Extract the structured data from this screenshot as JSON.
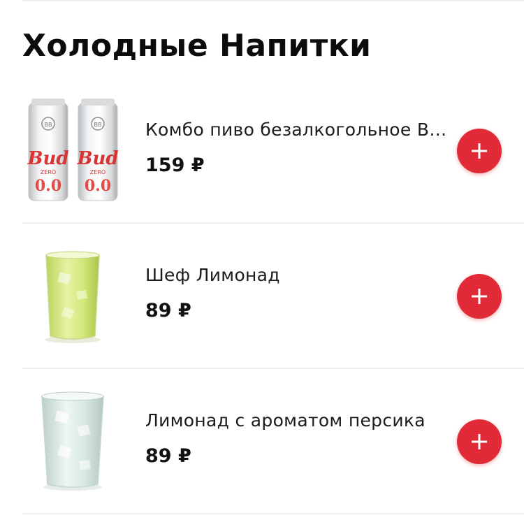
{
  "section": {
    "title": "Холодные Напитки"
  },
  "colors": {
    "accent": "#e02a38",
    "text": "#111111",
    "divider": "#ececec"
  },
  "products": [
    {
      "name": "Комбо пиво безалкогольное Bu...",
      "price": "159 ₽",
      "image": "beer-cans-image",
      "add_icon": "plus-icon"
    },
    {
      "name": "Шеф Лимонад",
      "price": "89 ₽",
      "image": "green-lemonade-glass-image",
      "add_icon": "plus-icon"
    },
    {
      "name": "Лимонад с ароматом персика",
      "price": "89 ₽",
      "image": "clear-lemonade-glass-image",
      "add_icon": "plus-icon"
    }
  ],
  "image_labels": {
    "can_brand": "Bud",
    "can_sub": "ZERO",
    "can_abv": "0.0"
  }
}
